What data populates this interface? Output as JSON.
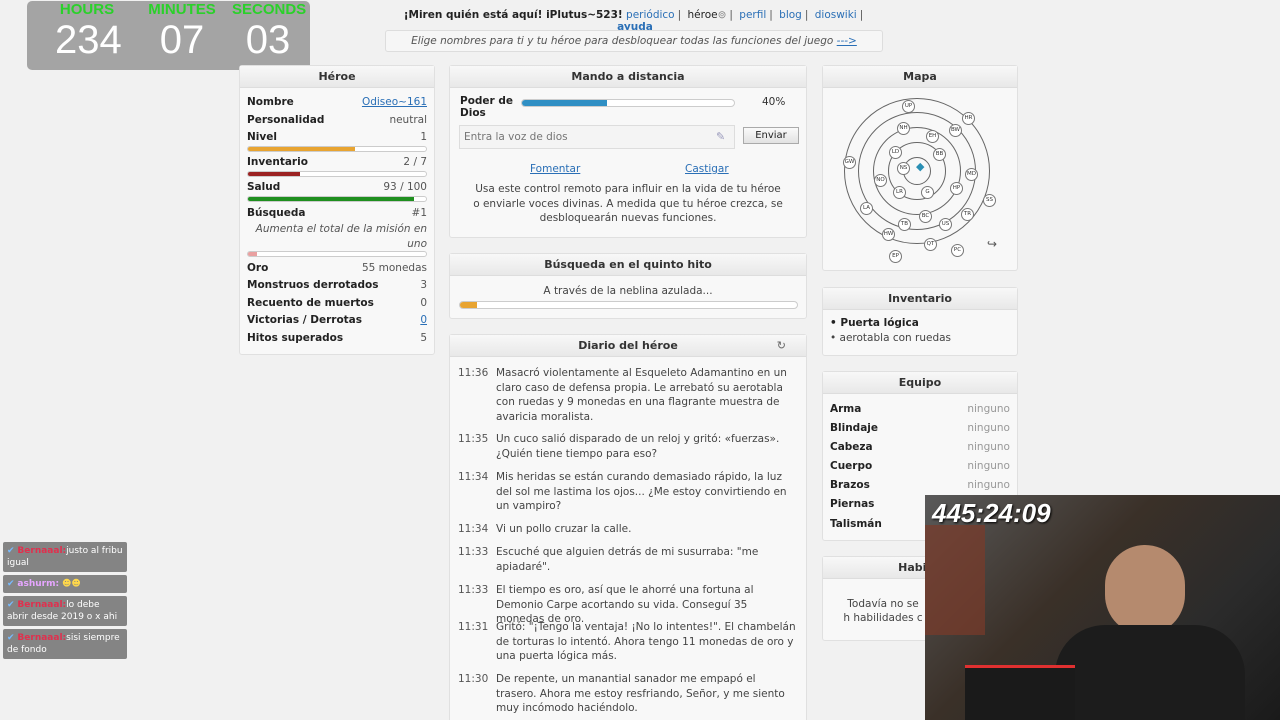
{
  "timer": {
    "hours_label": "HOURS",
    "minutes_label": "MINUTES",
    "seconds_label": "SECONDS",
    "hours": "234",
    "minutes": "07",
    "seconds": "03"
  },
  "topnav": {
    "greeting": "¡Miren quién está aquí! iPlutus~523!",
    "periodico": "periódico",
    "heroe": "héroe",
    "perfil": "perfil",
    "blog": "blog",
    "dioswiki": "dioswiki",
    "ayuda": "ayuda"
  },
  "banner": {
    "text": "Elige nombres para ti y tu héroe para desbloquear todas las funciones del juego",
    "link": "--->"
  },
  "hero": {
    "title": "Héroe",
    "nombre": {
      "k": "Nombre",
      "v": "Odiseo~161"
    },
    "personalidad": {
      "k": "Personalidad",
      "v": "neutral"
    },
    "nivel": {
      "k": "Nivel",
      "v": "1",
      "fill": 0.6
    },
    "inventario": {
      "k": "Inventario",
      "v": "2 / 7",
      "fill": 0.29
    },
    "salud": {
      "k": "Salud",
      "v": "93 / 100",
      "fill": 0.93
    },
    "busqueda": {
      "k": "Búsqueda",
      "v": "#1",
      "desc": "Aumenta el total de la misión en uno",
      "fill": 0.05
    },
    "oro": {
      "k": "Oro",
      "v": "55 monedas"
    },
    "monstruos": {
      "k": "Monstruos derrotados",
      "v": "3"
    },
    "muertos": {
      "k": "Recuento de muertos",
      "v": "0"
    },
    "victorias": {
      "k": "Victorias / Derrotas",
      "v": "0"
    },
    "hitos": {
      "k": "Hitos superados",
      "v": "5"
    }
  },
  "remote": {
    "title": "Mando a distancia",
    "poder_label": "Poder de Dios",
    "poder_pct": "40%",
    "poder_fill": 0.4,
    "voice_placeholder": "Entra la voz de dios",
    "send": "Enviar",
    "fomentar": "Fomentar",
    "castigar": "Castigar",
    "desc": "Usa este control remoto para influir en la vida de tu héroe o enviarle voces divinas. A medida que tu héroe crezca, se desbloquearán nuevas funciones."
  },
  "quest": {
    "title": "Búsqueda en el quinto hito",
    "text": "A través de la neblina azulada...",
    "fill": 0.05
  },
  "diary": {
    "title": "Diario del héroe",
    "entries": [
      {
        "t": "11:36",
        "m": "Masacró violentamente al Esqueleto Adamantino en un claro caso de defensa propia. Le arrebató su aerotabla con ruedas y 9 monedas en una flagrante muestra de avaricia moralista."
      },
      {
        "t": "11:35",
        "m": "Un cuco salió disparado de un reloj y gritó: «fuerzas». ¿Quién tiene tiempo para eso?"
      },
      {
        "t": "11:34",
        "m": "Mis heridas se están curando demasiado rápido, la luz del sol me lastima los ojos... ¿Me estoy convirtiendo en un vampiro?"
      },
      {
        "t": "11:34",
        "m": "Vi un pollo cruzar la calle."
      },
      {
        "t": "11:33",
        "m": "Escuché que alguien detrás de mi susurraba: \"me apiadaré\"."
      },
      {
        "t": "11:33",
        "m": "El tiempo es oro, así que le ahorré una fortuna al Demonio Carpe acortando su vida. Conseguí 35 monedas de oro."
      },
      {
        "t": "11:31",
        "m": "Gritó: \"¡Tengo la ventaja! ¡No lo intentes!\". El chambelán de torturas lo intentó. Ahora tengo 11 monedas de oro y una puerta lógica más."
      },
      {
        "t": "11:30",
        "m": "De repente, un manantial sanador me empapó el trasero. Ahora me estoy resfriando, Señor, y me siento muy incómodo haciéndolo."
      }
    ]
  },
  "map": {
    "title": "Mapa",
    "nodes": [
      "UP",
      "HR",
      "NH",
      "BW",
      "EH",
      "LD",
      "BB",
      "GW",
      "NS",
      "MD",
      "NO",
      "LR",
      "G",
      "HP",
      "SS",
      "LA",
      "BC",
      "TR",
      "TB",
      "US",
      "HW",
      "QT",
      "PC",
      "EP"
    ]
  },
  "inventory": {
    "title": "Inventario",
    "items": [
      "Puerta lógica",
      "aerotabla con ruedas"
    ]
  },
  "equipment": {
    "title": "Equipo",
    "rows": [
      {
        "k": "Arma",
        "v": "ninguno"
      },
      {
        "k": "Blindaje",
        "v": "ninguno"
      },
      {
        "k": "Cabeza",
        "v": "ninguno"
      },
      {
        "k": "Cuerpo",
        "v": "ninguno"
      },
      {
        "k": "Brazos",
        "v": "ninguno"
      },
      {
        "k": "Piernas",
        "v": ""
      },
      {
        "k": "Talismán",
        "v": ""
      }
    ]
  },
  "skills": {
    "title": "Habilid",
    "text": "Todavía no se h habilidades c"
  },
  "chat": [
    {
      "user": "Bernaaal:",
      "msg": "justo al fribu igual"
    },
    {
      "user": "ashurm:",
      "msg": ""
    },
    {
      "user": "Bernaaal:",
      "msg": "lo debe abrir desde 2019 o x ahi"
    },
    {
      "user": "Bernaaal:",
      "msg": "sisi siempre de fondo"
    }
  ],
  "cam_timer": "445:24:09",
  "colors": {
    "nivel": "#e8a431",
    "inventario": "#9b2222",
    "salud": "#1f8f1f",
    "poder": "#2f8fc4",
    "quest": "#e8a431",
    "timer_label": "#2ad12a"
  }
}
